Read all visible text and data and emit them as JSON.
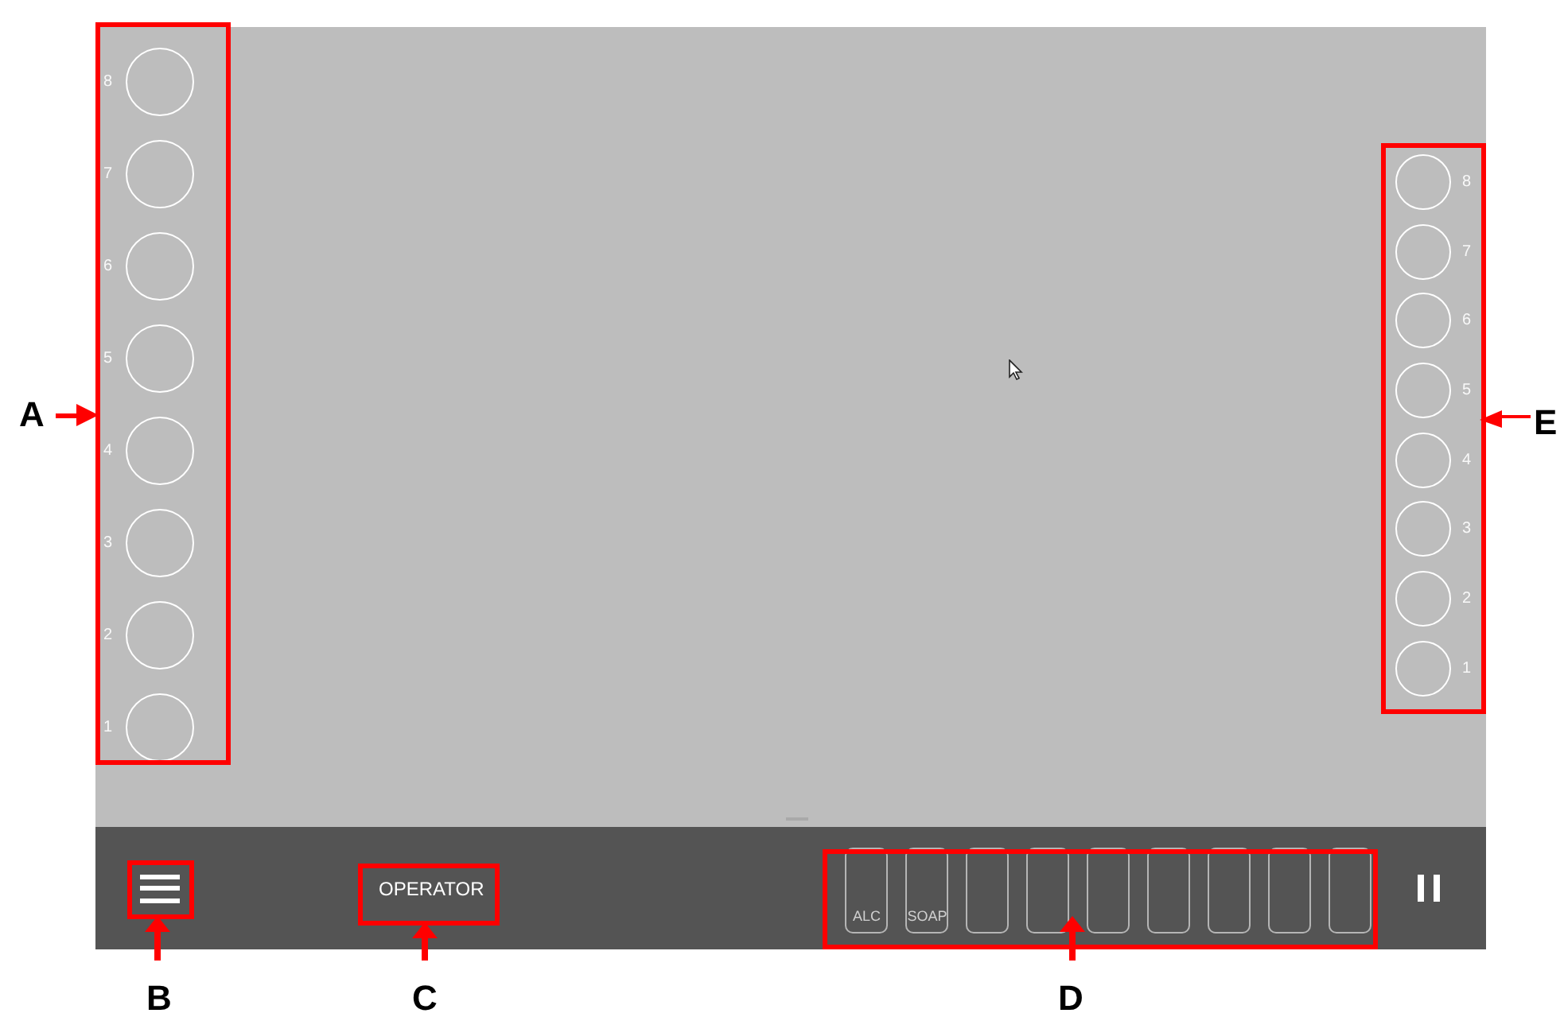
{
  "left_rack": {
    "slots": [
      "8",
      "7",
      "6",
      "5",
      "4",
      "3",
      "2",
      "1"
    ]
  },
  "right_rack": {
    "slots": [
      "8",
      "7",
      "6",
      "5",
      "4",
      "3",
      "2",
      "1"
    ]
  },
  "bottom_bar": {
    "mode_label": "OPERATOR",
    "containers": [
      {
        "kind": "labeled",
        "label": "ALC"
      },
      {
        "kind": "labeled",
        "label": "SOAP"
      },
      {
        "kind": "empty"
      },
      {
        "kind": "empty"
      },
      {
        "kind": "empty"
      },
      {
        "kind": "empty"
      },
      {
        "kind": "empty"
      },
      {
        "kind": "empty"
      },
      {
        "kind": "empty"
      }
    ]
  },
  "annotations": [
    {
      "letter": "A"
    },
    {
      "letter": "B"
    },
    {
      "letter": "C"
    },
    {
      "letter": "D"
    },
    {
      "letter": "E"
    }
  ]
}
